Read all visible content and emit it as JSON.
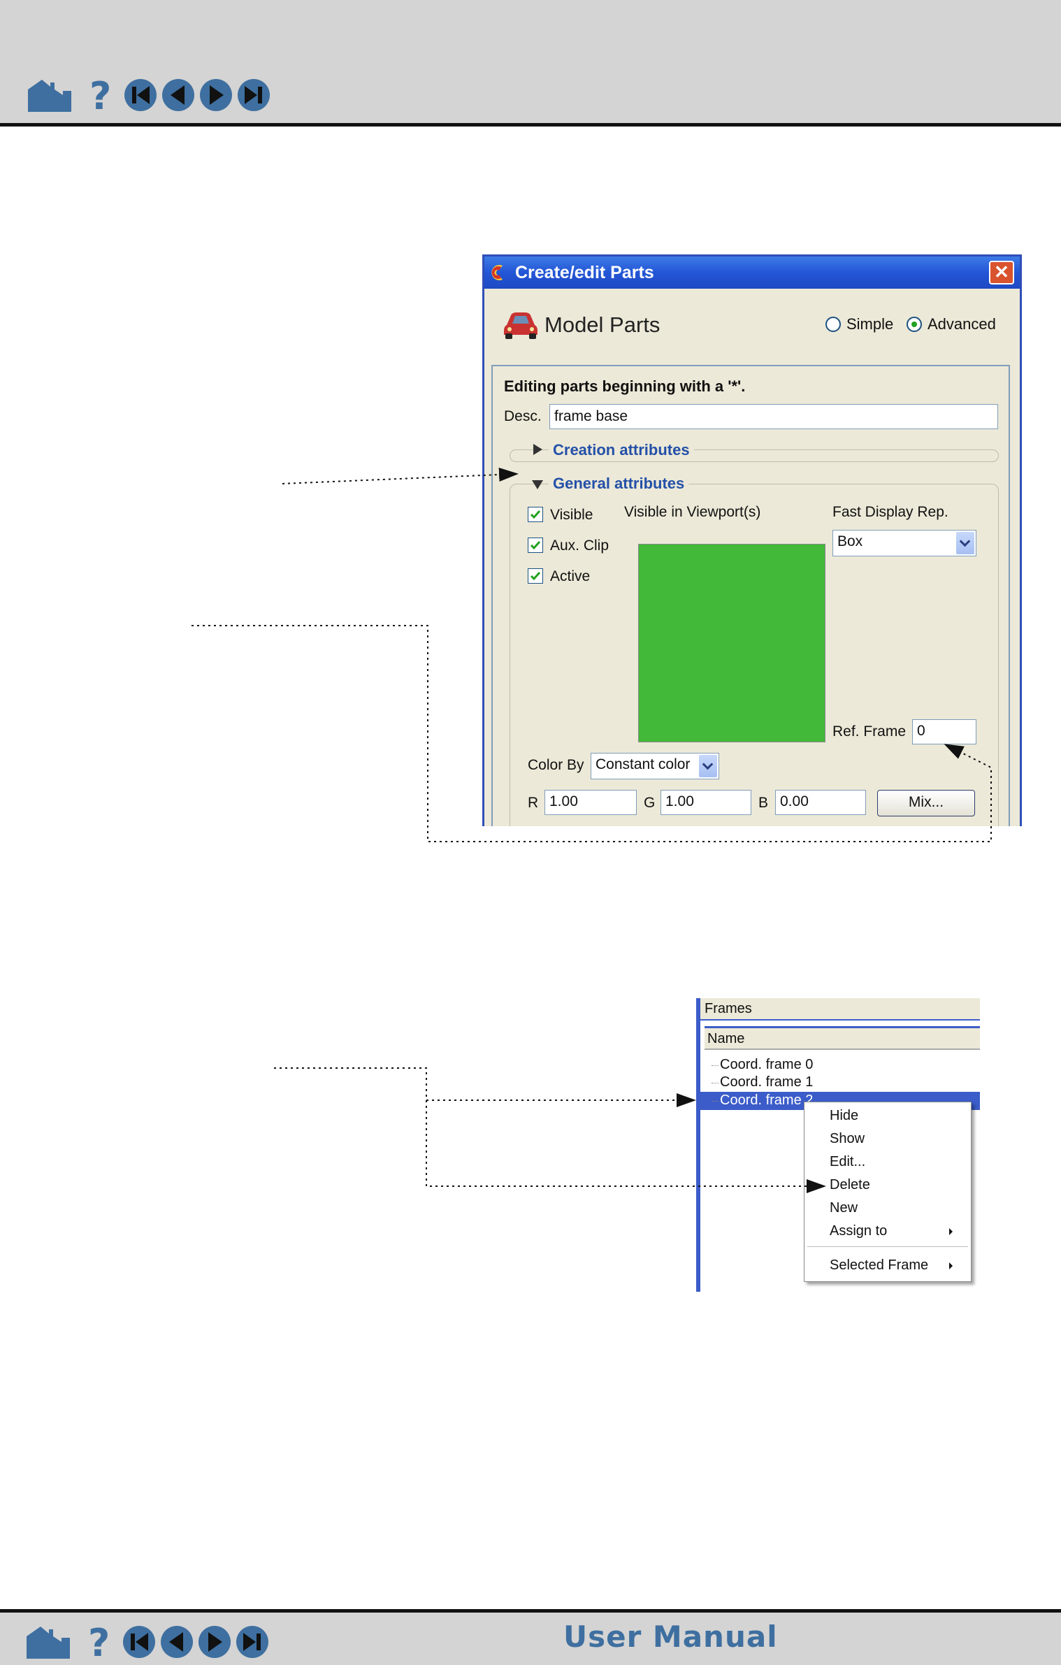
{
  "nav": {
    "icons": [
      "home-icon",
      "help-icon",
      "first-page-icon",
      "previous-page-icon",
      "next-page-icon",
      "last-page-icon"
    ],
    "footer_title": "User Manual",
    "bar_color": "#d4d4d4",
    "icon_color": "#3e6fa0"
  },
  "dialog": {
    "title": "Create/edit Parts",
    "section_title": "Model Parts",
    "mode_options": [
      "Simple",
      "Advanced"
    ],
    "selected_mode": "Advanced",
    "editing_heading": "Editing parts beginning with a '*'.",
    "desc_label": "Desc.",
    "desc_value": "frame base",
    "creation_attributes_label": "Creation attributes",
    "general_attributes_label": "General attributes",
    "checkboxes": [
      {
        "label": "Visible",
        "checked": true
      },
      {
        "label": "Aux. Clip",
        "checked": true
      },
      {
        "label": "Active",
        "checked": true
      }
    ],
    "viewport_label": "Visible in Viewport(s)",
    "viewport_color": "#43b93a",
    "fast_display_label": "Fast Display Rep.",
    "fast_display_value": "Box",
    "ref_frame_label": "Ref. Frame",
    "ref_frame_value": "0",
    "color_by_label": "Color By",
    "color_by_value": "Constant color",
    "r_label": "R",
    "r_value": "1.00",
    "g_label": "G",
    "g_value": "1.00",
    "b_label": "B",
    "b_value": "0.00",
    "mix_button": "Mix...",
    "titlebar_color": "#2356d6",
    "accent_label_color": "#2450a8"
  },
  "frames": {
    "panel_title": "Frames",
    "column_header": "Name",
    "items": [
      "Coord. frame 0",
      "Coord. frame 1",
      "Coord. frame 2"
    ],
    "selected_index": 2,
    "selected_visible_text": "Coord. frame 2",
    "context_menu": {
      "items": [
        "Hide",
        "Show",
        "Edit...",
        "Delete",
        "New",
        "Assign to"
      ],
      "submenu_items": [
        "Assign to",
        "Selected Frame"
      ],
      "bottom_item": "Selected Frame"
    },
    "selection_color": "#3b5cc9"
  }
}
